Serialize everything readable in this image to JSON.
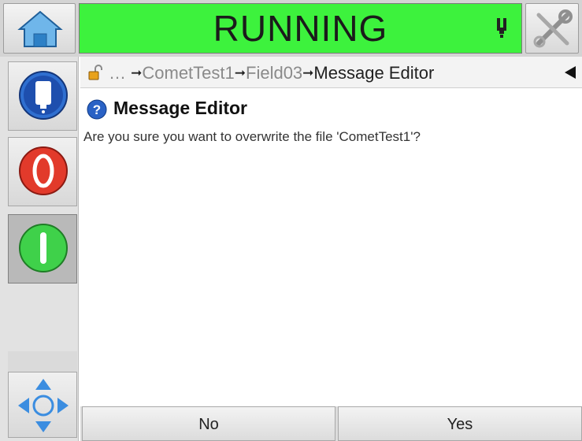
{
  "status": {
    "text": "RUNNING",
    "color": "#3df23d"
  },
  "icons": {
    "home": "home-icon",
    "printhead": "printhead-icon",
    "tools": "tools-icon",
    "ink": "ink-icon",
    "stop": "stop-icon",
    "start": "start-icon",
    "navigate": "navigate-icon",
    "lock": "unlocked-padlock-icon",
    "help": "help-icon"
  },
  "breadcrumb": {
    "ellipsis": "…",
    "items": [
      "CometTest1",
      "Field03"
    ],
    "current": "Message Editor",
    "arrow": "➞"
  },
  "dialog": {
    "title": "Message Editor",
    "message": "Are you sure you want to overwrite the file 'CometTest1'?"
  },
  "buttons": {
    "no": "No",
    "yes": "Yes"
  }
}
